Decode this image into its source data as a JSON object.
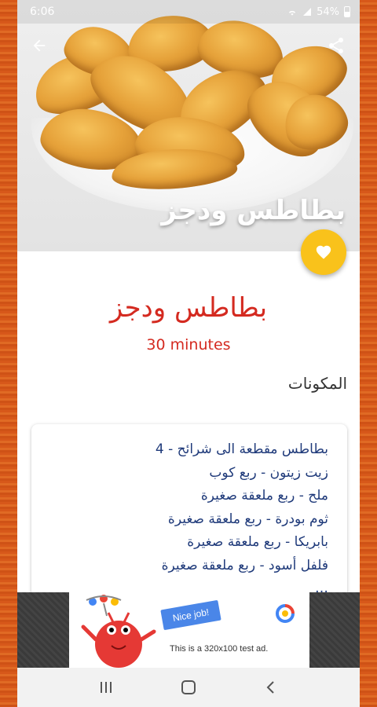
{
  "status_bar": {
    "time": "6:06",
    "battery": "54%"
  },
  "hero": {
    "title": "بطاطس ودجز"
  },
  "recipe": {
    "title": "بطاطس ودجز",
    "time": "30 minutes",
    "ingredients_label": "المكونات",
    "ingredients": [
      "بطاطس مقطعة الى شرائح - 4",
      "زيت زيتون - ربع كوب",
      "ملح - ربع ملعقة صغيرة",
      "ثوم بودرة - ربع ملعقة صغيرة",
      "بابريكا - ربع ملعقة صغيرة",
      "فلفل أسود - ربع ملعقة صغيرة",
      "…"
    ]
  },
  "ad": {
    "badge": "Nice job!",
    "text": "This is a 320x100 test ad."
  },
  "icons": {
    "back": "arrow-back-icon",
    "share": "share-icon",
    "favorite": "heart-icon",
    "nav_recents": "recents-icon",
    "nav_home": "home-icon",
    "nav_back": "nav-back-icon"
  },
  "colors": {
    "frame": "#d9601c",
    "title_red": "#d42a20",
    "ingredient_blue": "#1f3a7a",
    "fab_yellow": "#f9c21b"
  }
}
